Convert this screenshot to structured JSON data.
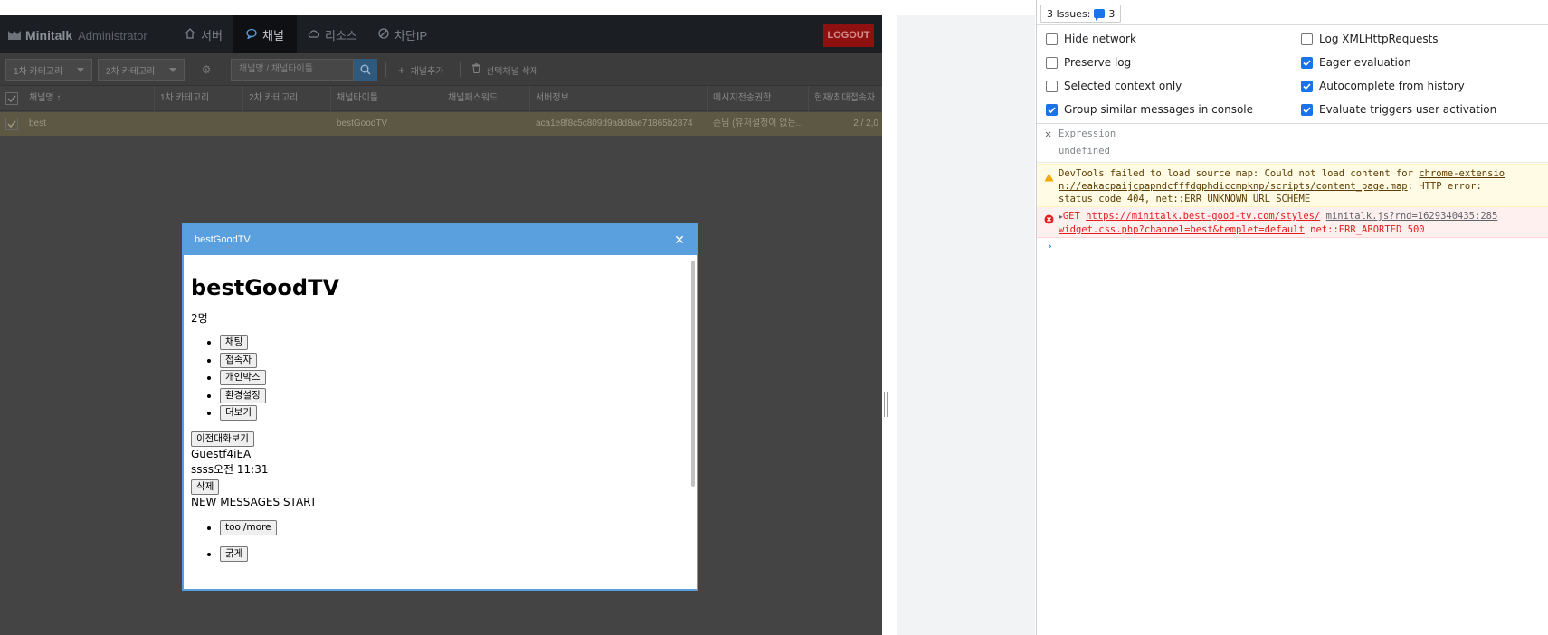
{
  "admin": {
    "logo": {
      "brand": "Minitalk",
      "sub": "Administrator"
    },
    "nav": [
      {
        "label": "서버",
        "icon": "home-icon"
      },
      {
        "label": "채널",
        "icon": "chat-bubble-icon"
      },
      {
        "label": "리소스",
        "icon": "cloud-icon"
      },
      {
        "label": "차단IP",
        "icon": "block-icon"
      }
    ],
    "logout_label": "LOGOUT",
    "toolbar": {
      "category1": "1차 카테고리",
      "category2": "2차 카테고리",
      "search_placeholder": "채널명 / 채널타이틀",
      "add_channel": "채널추가",
      "delete_selected": "선택채널 삭제"
    },
    "grid": {
      "columns": [
        "채널명 ↑",
        "1차 카테고리",
        "2차 카테고리",
        "채널타이틀",
        "채널패스워드",
        "서버정보",
        "메시지전송권한",
        "현재/최대접속자"
      ],
      "rows": [
        {
          "name": "best",
          "cat1": "",
          "cat2": "",
          "title": "bestGoodTV",
          "password": "",
          "server": "aca1e8f8c5c809d9a8d8ae71865b2874",
          "permission": "손님 (유저설정이 없는...",
          "users": "2 / 2,0"
        }
      ]
    }
  },
  "modal": {
    "header_title": "bestGoodTV",
    "page_title": "bestGoodTV",
    "user_count": "2명",
    "tabs": [
      "채팅",
      "접속자",
      "개인박스",
      "환경설정",
      "더보기"
    ],
    "history_button": "이전대화보기",
    "message_user": "Guestf4iEA",
    "message_text": "ssss",
    "message_time": "오전 11:31",
    "delete_button": "삭제",
    "new_messages": "NEW MESSAGES START",
    "tool_buttons": [
      "tool/more",
      "굵게"
    ]
  },
  "devtools": {
    "issues_label": "3 Issues:",
    "issues_count": "3",
    "options_left": [
      {
        "label": "Hide network",
        "checked": false
      },
      {
        "label": "Preserve log",
        "checked": false
      },
      {
        "label": "Selected context only",
        "checked": false
      },
      {
        "label": "Group similar messages in console",
        "checked": true
      }
    ],
    "options_right": [
      {
        "label": "Log XMLHttpRequests",
        "checked": false
      },
      {
        "label": "Eager evaluation",
        "checked": true
      },
      {
        "label": "Autocomplete from history",
        "checked": true
      },
      {
        "label": "Evaluate triggers user activation",
        "checked": true
      }
    ],
    "expression_label": "Expression",
    "expression_value": "undefined",
    "warning": {
      "prefix": "DevTools failed to load source map: Could not load content for ",
      "link1": "chrome-extensio",
      "link2": "n://eakacpaijcpapndcfffdgphdiccmpknp/scripts/content_page.map",
      "suffix1": ": HTTP error:",
      "line3": "status code 404, net::ERR_UNKNOWN_URL_SCHEME"
    },
    "error": {
      "method": "GET",
      "url1": "https://minitalk.best-good-tv.com/styles/",
      "source": "minitalk.js?rnd=1629340435:285",
      "url2": "widget.css.php?channel=best&templet=default",
      "status": "net::ERR_ABORTED 500"
    },
    "prompt": "›"
  },
  "colors": {
    "overlay_bg": "#444444",
    "modal_header": "#5ba0de",
    "logout_bg": "#8e1010",
    "checkbox_on": "#1a73e8",
    "warning_bg": "#fffbe5",
    "error_bg": "#fff0f0",
    "error_text": "#e41e1e"
  }
}
